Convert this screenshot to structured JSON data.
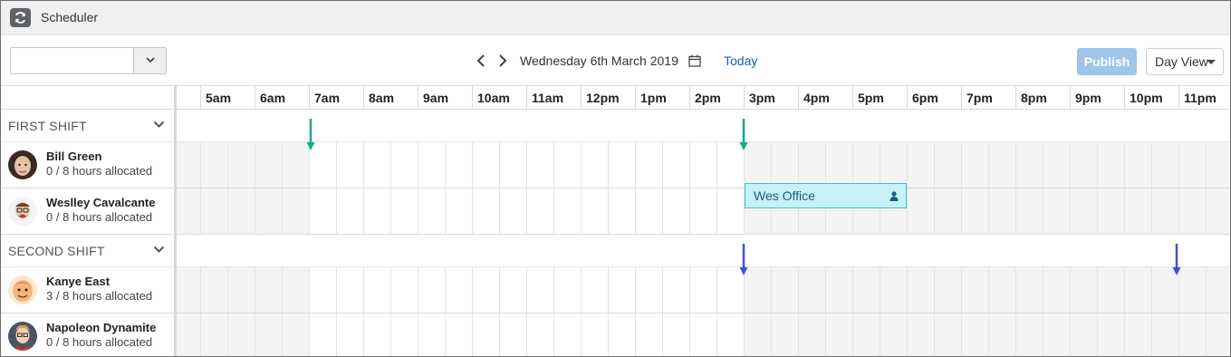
{
  "app": {
    "title": "Scheduler"
  },
  "toolbar": {
    "select_value": "",
    "date": "Wednesday 6th March 2019",
    "today_label": "Today",
    "publish_label": "Publish",
    "view_label": "Day View"
  },
  "timeline": {
    "hours": [
      "5am",
      "6am",
      "7am",
      "8am",
      "9am",
      "10am",
      "11am",
      "12pm",
      "1pm",
      "2pm",
      "3pm",
      "4pm",
      "5pm",
      "6pm",
      "7pm",
      "8pm",
      "9pm",
      "10pm",
      "11pm"
    ]
  },
  "groups": [
    {
      "label": "FIRST SHIFT",
      "arrow_color": "#1aa98a",
      "employees": [
        {
          "name": "Bill Green",
          "hours": "0 / 8 hours allocated"
        },
        {
          "name": "Weslley Cavalcante",
          "hours": "0 / 8 hours allocated"
        }
      ]
    },
    {
      "label": "SECOND SHIFT",
      "arrow_color": "#3b55d6",
      "employees": [
        {
          "name": "Kanye East",
          "hours": "3 / 8 hours allocated"
        },
        {
          "name": "Napoleon Dynamite",
          "hours": "0 / 8 hours allocated"
        }
      ]
    }
  ],
  "shift_block": {
    "label": "Wes Office",
    "color": "#c4f2f7"
  }
}
